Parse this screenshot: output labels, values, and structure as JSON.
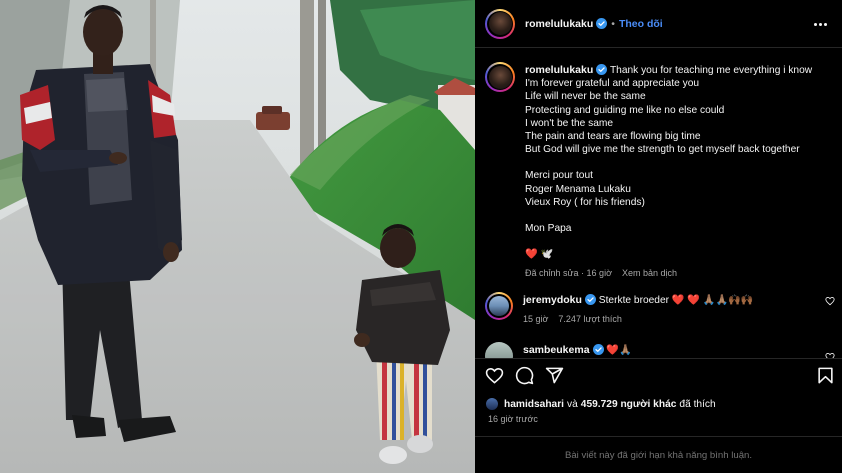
{
  "post": {
    "username": "romelulukaku",
    "follow_label": "Theo dõi",
    "caption_username": "romelulukaku",
    "caption_lines": [
      "Thank you for teaching me everything i know",
      "I'm forever grateful and appreciate you",
      "Life will never be the same",
      "Protecting and guiding me like no else could",
      "I won't be the same",
      "The pain and tears are flowing big time",
      "But God will give me the strength to get myself back together",
      "",
      "Merci pour tout",
      "Roger Menama Lukaku",
      "Vieux Roy ( for his friends)",
      "",
      "Mon Papa",
      "",
      "❤️ 🕊️"
    ],
    "caption_edited": "Đã chỉnh sửa · 16 giờ",
    "see_translation": "Xem bản dịch"
  },
  "comments": [
    {
      "username": "jeremydoku",
      "text": "Sterkte broeder ❤️ ❤️ 🙏🏽🙏🏽🙌🏾🙌🏾",
      "time": "15 giờ",
      "likes": "7.247 lượt thích"
    },
    {
      "username": "sambeukema",
      "text": "❤️🙏🏽"
    }
  ],
  "likes": {
    "first_user": "hamidsahari",
    "connector": "và",
    "others": "459.729 người khác",
    "suffix": "đã thích"
  },
  "timestamp": "16 giờ trước",
  "comments_limited": "Bài viết này đã giới hạn khả năng bình luận.",
  "icons": [
    "verified-badge-icon",
    "more-options-icon",
    "heart-icon",
    "comment-icon",
    "share-icon",
    "bookmark-icon"
  ],
  "colors": {
    "accent": "#4a8df8",
    "verified": "#3897f0",
    "background": "#000000",
    "muted": "#a8a8a8"
  }
}
